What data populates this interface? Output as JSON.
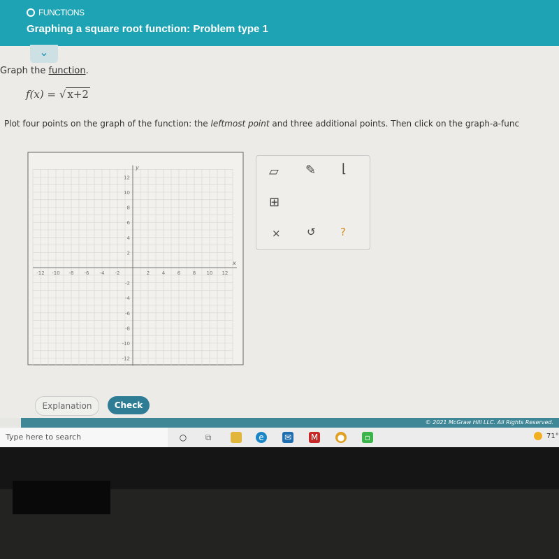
{
  "header": {
    "section": "FUNCTIONS",
    "title": "Graphing a square root function: Problem type 1"
  },
  "question": {
    "prefix": "Graph the ",
    "link": "function",
    "suffix": ".",
    "formula_lhs": "f(x) = ",
    "formula_radicand": "x+2",
    "instr_a": "Plot four points on the graph of the function: the ",
    "instr_em": "leftmost point",
    "instr_b": " and three additional points. Then click on the graph-a-func"
  },
  "graph": {
    "x_label": "x",
    "y_label": "y",
    "x_range": [
      -13,
      13
    ],
    "y_range": [
      -13,
      13
    ],
    "tick_labels": [
      -12,
      -10,
      -8,
      -6,
      -4,
      -2,
      2,
      4,
      6,
      8,
      10,
      12
    ]
  },
  "tools": {
    "eraser": "eraser-icon",
    "pencil": "pencil-icon",
    "curve": "curve-icon",
    "grid": "grid-point-icon",
    "clear": "×",
    "undo": "↺",
    "help": "?"
  },
  "buttons": {
    "explanation": "Explanation",
    "check": "Check"
  },
  "footer": {
    "copyright": "© 2021 McGraw Hill LLC. All Rights Reserved."
  },
  "taskbar": {
    "search_placeholder": "Type here to search",
    "weather": "71°"
  },
  "colors": {
    "header": "#1ea3b4",
    "check": "#2e7d94"
  }
}
